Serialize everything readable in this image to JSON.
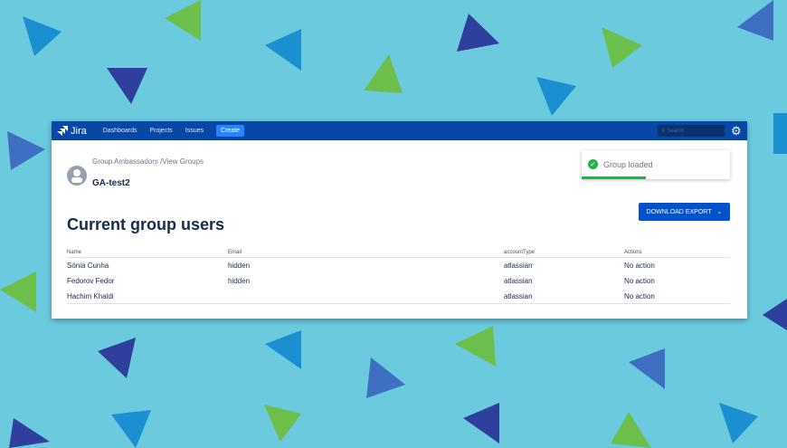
{
  "nav": {
    "brand": "Jira",
    "items": [
      "Dashboards",
      "Projects",
      "Issues"
    ],
    "create": "Create",
    "search_placeholder": "Search"
  },
  "breadcrumb": "Group Ambassadors  /View Groups",
  "group_name": "GA-test2",
  "page_title": "Current group users",
  "download_button": "DOWNLOAD EXPORT",
  "toast": {
    "message": "Group loaded",
    "progress": 0.43,
    "color": "#22b14c"
  },
  "table": {
    "headers": [
      "Name",
      "Email",
      "accountType",
      "Actions"
    ],
    "rows": [
      [
        "Sónia Cunha",
        "hidden",
        "atlassian",
        "No action"
      ],
      [
        "Fedorov Fedor",
        "hidden",
        "atlassian",
        "No action"
      ],
      [
        "Hachim Khaldi",
        "",
        "atlassian",
        "No action"
      ]
    ]
  }
}
